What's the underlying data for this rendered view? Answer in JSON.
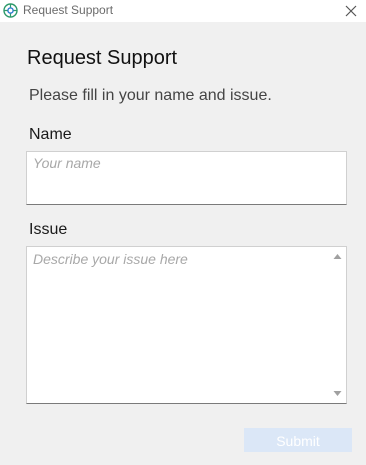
{
  "window": {
    "title": "Request Support",
    "app_icon": "support-app-icon",
    "close_icon": "close-icon"
  },
  "form": {
    "heading": "Request Support",
    "subtitle": "Please fill in your name and issue.",
    "name": {
      "label": "Name",
      "value": "",
      "placeholder": "Your name"
    },
    "issue": {
      "label": "Issue",
      "value": "",
      "placeholder": "Describe your issue here"
    },
    "submit_label": "Submit",
    "submit_enabled": false
  },
  "colors": {
    "window_background": "#f0f0f0",
    "titlebar_background": "#ffffff",
    "submit_disabled": "#dbe7f7",
    "app_icon_accent": "#2e9a6b"
  }
}
